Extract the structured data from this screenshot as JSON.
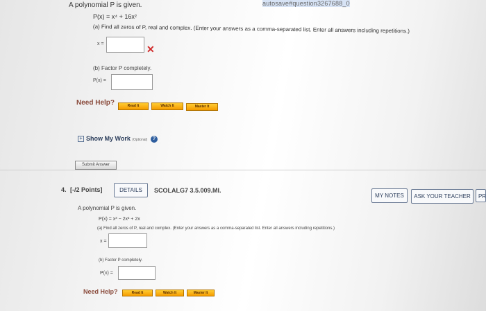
{
  "browser": {
    "url_tail": "autosave#question3267688_0"
  },
  "q1": {
    "intro": "A polynomial P is given.",
    "equation": "P(x) = x⁴ + 16x²",
    "part_a": "(a) Find all zeros of P, real and complex. (Enter your answers as a comma-separated list. Enter all answers including repetitions.)",
    "x_label": "x =",
    "part_b": "(b) Factor P completely.",
    "px_label": "P(x) =",
    "need_help": "Need Help?",
    "help_buttons": [
      "Read It",
      "Watch It",
      "Master It"
    ],
    "show_work": "Show My Work",
    "optional": "(Optional)",
    "submit": "Submit Answer"
  },
  "q2": {
    "number": "4.",
    "points": "[-/2 Points]",
    "details": "DETAILS",
    "code": "SCOLALG7 3.5.009.MI.",
    "my_notes": "MY NOTES",
    "ask_teacher": "ASK YOUR TEACHER",
    "practice": "PR",
    "intro": "A polynomial P is given.",
    "equation": "P(x) = x³ − 2x² + 2x",
    "part_a": "(a) Find all zeros of P, real and complex. (Enter your answers as a comma-separated list. Enter all answers including repetitions.)",
    "x_label": "x =",
    "part_b": "(b) Factor P completely.",
    "px_label": "P(x) =",
    "need_help": "Need Help?",
    "help_buttons": [
      "Read It",
      "Watch It",
      "Master It"
    ]
  }
}
